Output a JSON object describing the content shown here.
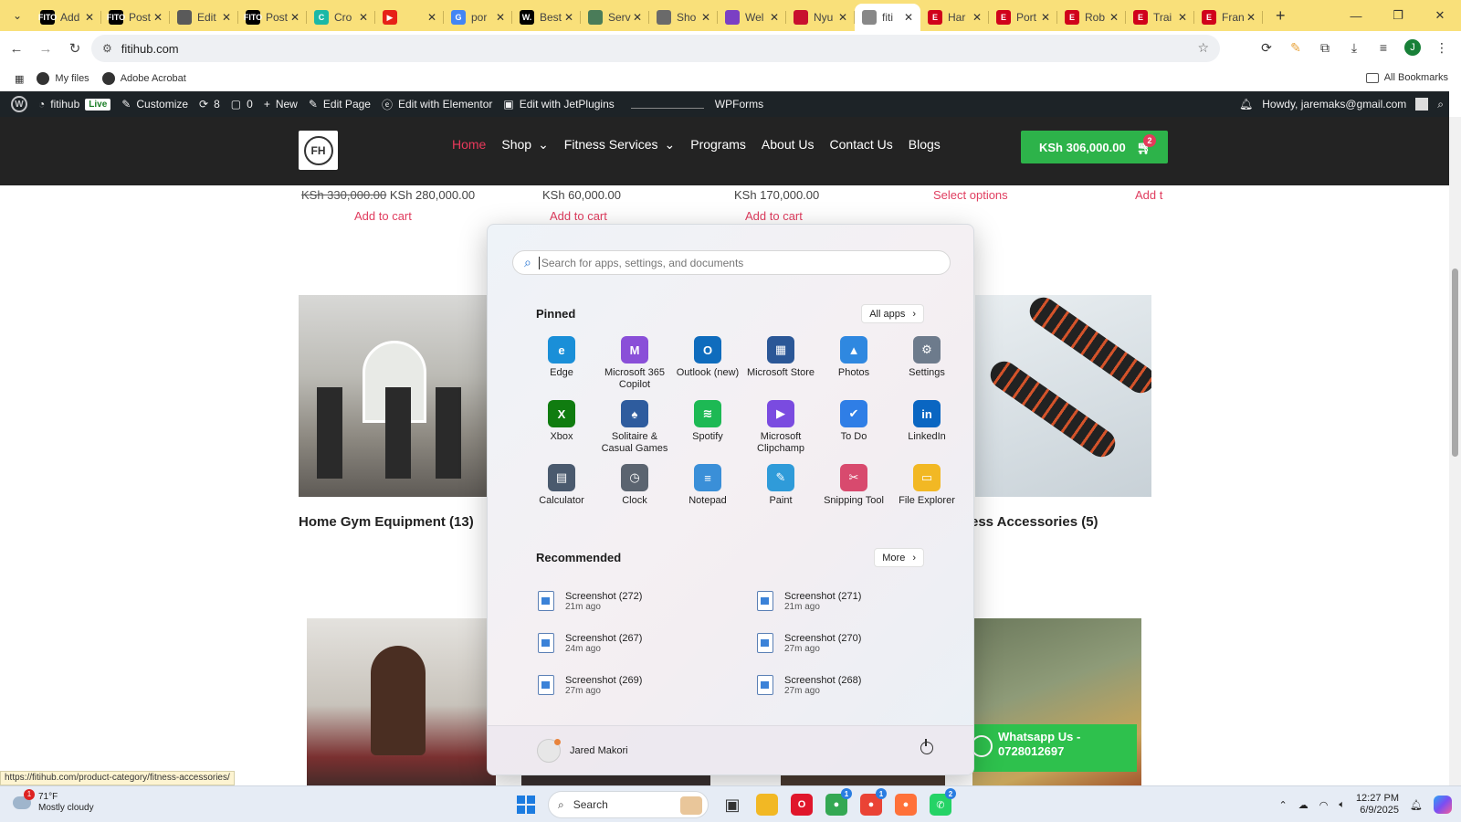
{
  "browser": {
    "tabs": [
      {
        "title": "Add",
        "fav_text": "FITO",
        "fav_color": "#000000",
        "active": false
      },
      {
        "title": "Post",
        "fav_text": "FITO",
        "fav_color": "#000000",
        "active": false
      },
      {
        "title": "Edit",
        "fav_text": "",
        "fav_color": "#5a5a5a",
        "active": false
      },
      {
        "title": "Post",
        "fav_text": "FITO",
        "fav_color": "#000000",
        "active": false
      },
      {
        "title": "Cro",
        "fav_text": "C",
        "fav_color": "#1bb8a6",
        "active": false
      },
      {
        "title": "",
        "fav_text": "▶",
        "fav_color": "#e62117",
        "active": false
      },
      {
        "title": "por",
        "fav_text": "G",
        "fav_color": "#4285f4",
        "active": false
      },
      {
        "title": "Best",
        "fav_text": "W.",
        "fav_color": "#000000",
        "active": false
      },
      {
        "title": "Serv",
        "fav_text": "",
        "fav_color": "#4a7c59",
        "active": false
      },
      {
        "title": "Sho",
        "fav_text": "",
        "fav_color": "#6a6a6a",
        "active": false
      },
      {
        "title": "Wel",
        "fav_text": "",
        "fav_color": "#7b3fc4",
        "active": false
      },
      {
        "title": "Nyu",
        "fav_text": "",
        "fav_color": "#c8102e",
        "active": false
      },
      {
        "title": "fiti",
        "fav_text": "",
        "fav_color": "#888888",
        "active": true
      },
      {
        "title": "Har",
        "fav_text": "E",
        "fav_color": "#d0021b",
        "active": false
      },
      {
        "title": "Port",
        "fav_text": "E",
        "fav_color": "#d0021b",
        "active": false
      },
      {
        "title": "Rob",
        "fav_text": "E",
        "fav_color": "#d0021b",
        "active": false
      },
      {
        "title": "Trai",
        "fav_text": "E",
        "fav_color": "#d0021b",
        "active": false
      },
      {
        "title": "Fran",
        "fav_text": "E",
        "fav_color": "#d0021b",
        "active": false
      }
    ],
    "url": "fitihub.com",
    "bookmarks": {
      "my_files": "My files",
      "acrobat": "Adobe Acrobat",
      "all": "All Bookmarks"
    },
    "avatar_letter": "J"
  },
  "wpbar": {
    "site": "fitihub",
    "live": "Live",
    "customize": "Customize",
    "updates": "8",
    "comments": "0",
    "new": "New",
    "edit_page": "Edit Page",
    "elementor": "Edit with Elementor",
    "jetplugins": "Edit with JetPlugins",
    "wpforms": "WPForms",
    "howdy": "Howdy, jaremaks@gmail.com"
  },
  "site": {
    "nav": [
      "Home",
      "Shop",
      "Fitness Services",
      "Programs",
      "About Us",
      "Contact Us",
      "Blogs"
    ],
    "cart_total": "KSh 306,000.00",
    "cart_count": "2",
    "logo_text": "FH"
  },
  "content": {
    "products": [
      {
        "old_price": "KSh 330,000.00",
        "price": "KSh 280,000.00",
        "action": "Add to cart"
      },
      {
        "old_price": "",
        "price": "KSh 60,000.00",
        "action": "Add to cart"
      },
      {
        "old_price": "",
        "price": "KSh 170,000.00",
        "action": "Add to cart"
      },
      {
        "old_price": "",
        "price": "",
        "action": "Select options"
      },
      {
        "old_price": "",
        "price": "",
        "action": "Add t"
      }
    ],
    "categories": {
      "left": "Home Gym Equipment (13)",
      "right": "ess Accessories (5)"
    },
    "whatsapp_line1": "Whatsapp Us -",
    "whatsapp_line2": "0728012697",
    "status_url": "https://fitihub.com/product-category/fitness-accessories/"
  },
  "startmenu": {
    "search_placeholder": "Search for apps, settings, and documents",
    "pinned_label": "Pinned",
    "all_apps": "All apps",
    "pinned": [
      {
        "name": "Edge",
        "icon": "edge-icon",
        "color": "#1a8fd8",
        "glyph": "e"
      },
      {
        "name": "Microsoft 365 Copilot",
        "icon": "m365-icon",
        "color": "#8a4fd8",
        "glyph": "M"
      },
      {
        "name": "Outlook (new)",
        "icon": "outlook-icon",
        "color": "#0f6cbd",
        "glyph": "O"
      },
      {
        "name": "Microsoft Store",
        "icon": "store-icon",
        "color": "#2b5797",
        "glyph": "▦"
      },
      {
        "name": "Photos",
        "icon": "photos-icon",
        "color": "#2f88e0",
        "glyph": "▲"
      },
      {
        "name": "Settings",
        "icon": "settings-icon",
        "color": "#6d7b8c",
        "glyph": "⚙"
      },
      {
        "name": "Xbox",
        "icon": "xbox-icon",
        "color": "#107c10",
        "glyph": "X"
      },
      {
        "name": "Solitaire & Casual Games",
        "icon": "solitaire-icon",
        "color": "#2e5c9e",
        "glyph": "♠"
      },
      {
        "name": "Spotify",
        "icon": "spotify-icon",
        "color": "#1db954",
        "glyph": "≋"
      },
      {
        "name": "Microsoft Clipchamp",
        "icon": "clipchamp-icon",
        "color": "#7a4be0",
        "glyph": "▶"
      },
      {
        "name": "To Do",
        "icon": "todo-icon",
        "color": "#2f7ee6",
        "glyph": "✔"
      },
      {
        "name": "LinkedIn",
        "icon": "linkedin-icon",
        "color": "#0a66c2",
        "glyph": "in"
      },
      {
        "name": "Calculator",
        "icon": "calculator-icon",
        "color": "#4a5a6e",
        "glyph": "▤"
      },
      {
        "name": "Clock",
        "icon": "clock-icon",
        "color": "#5b6470",
        "glyph": "◷"
      },
      {
        "name": "Notepad",
        "icon": "notepad-icon",
        "color": "#3a8fd8",
        "glyph": "≡"
      },
      {
        "name": "Paint",
        "icon": "paint-icon",
        "color": "#2f9bd9",
        "glyph": "✎"
      },
      {
        "name": "Snipping Tool",
        "icon": "snipping-icon",
        "color": "#d84a6e",
        "glyph": "✂"
      },
      {
        "name": "File Explorer",
        "icon": "folder-icon",
        "color": "#f2b824",
        "glyph": "▭"
      }
    ],
    "recommended_label": "Recommended",
    "more": "More",
    "recommended": [
      {
        "name": "Screenshot (272)",
        "time": "21m ago"
      },
      {
        "name": "Screenshot (271)",
        "time": "21m ago"
      },
      {
        "name": "Screenshot (267)",
        "time": "24m ago"
      },
      {
        "name": "Screenshot (270)",
        "time": "27m ago"
      },
      {
        "name": "Screenshot (269)",
        "time": "27m ago"
      },
      {
        "name": "Screenshot (268)",
        "time": "27m ago"
      }
    ],
    "user": "Jared Makori"
  },
  "taskbar": {
    "temp": "71°F",
    "weather": "Mostly cloudy",
    "weather_badge": "1",
    "search": "Search",
    "time": "12:27 PM",
    "date": "6/9/2025",
    "apps": [
      {
        "name": "task-view",
        "color": "#3a3a3a",
        "glyph": "▣",
        "badge": ""
      },
      {
        "name": "file-explorer",
        "color": "#f2b824",
        "glyph": "",
        "badge": ""
      },
      {
        "name": "opera",
        "color": "#e0162b",
        "glyph": "O",
        "badge": ""
      },
      {
        "name": "chrome",
        "color": "#34a853",
        "glyph": "●",
        "badge": "1"
      },
      {
        "name": "chrome-profile",
        "color": "#ea4335",
        "glyph": "●",
        "badge": "1"
      },
      {
        "name": "firefox",
        "color": "#ff7139",
        "glyph": "●",
        "badge": ""
      },
      {
        "name": "whatsapp",
        "color": "#25d366",
        "glyph": "✆",
        "badge": "2"
      }
    ]
  }
}
